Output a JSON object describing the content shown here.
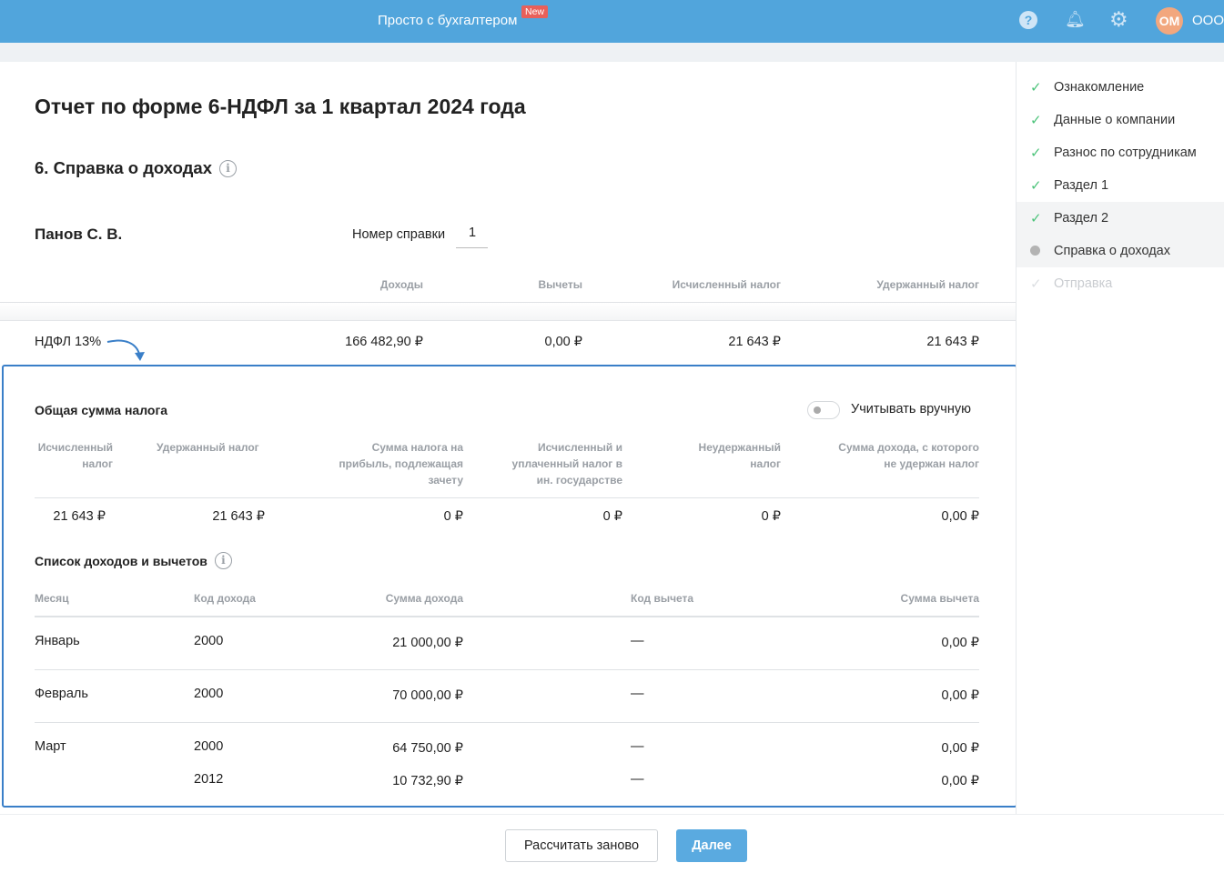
{
  "header": {
    "title": "Просто с бухгалтером",
    "badge": "New",
    "avatar": "ОМ",
    "company": "ООО",
    "icons": [
      "help-icon",
      "bell-icon",
      "gear-icon"
    ]
  },
  "page": {
    "title": "Отчет по форме 6-НДФЛ за 1 квартал 2024 года",
    "section": "6. Справка о доходах",
    "employee": "Панов С. В.",
    "cert_label": "Номер справки",
    "cert_number": "1"
  },
  "summary": {
    "headers": [
      "Доходы",
      "Вычеты",
      "Исчисленный налог",
      "Удержанный налог"
    ],
    "row": {
      "label": "НДФЛ 13%",
      "values": [
        "166 482,90 ₽",
        "0,00 ₽",
        "21 643 ₽",
        "21 643 ₽"
      ]
    }
  },
  "tax": {
    "title": "Общая сумма налога",
    "toggle_label": "Учитывать вручную",
    "toggle_on": false,
    "headers": [
      "Исчисленный налог",
      "Удержанный налог",
      "Сумма налога на прибыль, подлежащая зачету",
      "Исчисленный и уплаченный налог в ин. государстве",
      "Неудержанный налог",
      "Сумма дохода, с которого не удержан налог"
    ],
    "values": [
      "21 643 ₽",
      "21 643 ₽",
      "0 ₽",
      "0 ₽",
      "0 ₽",
      "0,00 ₽"
    ]
  },
  "income": {
    "title": "Список доходов и вычетов",
    "headers": [
      "Месяц",
      "Код дохода",
      "Сумма дохода",
      "Код вычета",
      "Сумма вычета"
    ],
    "rows": [
      {
        "month": "Январь",
        "code": "2000",
        "amount": "21 000,00 ₽",
        "ded_code": "—",
        "ded_amount": "0,00 ₽"
      },
      {
        "month": "Февраль",
        "code": "2000",
        "amount": "70 000,00 ₽",
        "ded_code": "—",
        "ded_amount": "0,00 ₽"
      },
      {
        "month": "Март",
        "code": "2000",
        "amount": "64 750,00 ₽",
        "ded_code": "—",
        "ded_amount": "0,00 ₽"
      },
      {
        "month": "",
        "code": "2012",
        "amount": "10 732,90 ₽",
        "ded_code": "—",
        "ded_amount": "0,00 ₽"
      }
    ]
  },
  "steps": [
    {
      "label": "Ознакомление",
      "state": "done"
    },
    {
      "label": "Данные о компании",
      "state": "done"
    },
    {
      "label": "Разнос по сотрудникам",
      "state": "done"
    },
    {
      "label": "Раздел 1",
      "state": "done"
    },
    {
      "label": "Раздел 2",
      "state": "done"
    },
    {
      "label": "Справка о доходах",
      "state": "current"
    },
    {
      "label": "Отправка",
      "state": "disabled"
    }
  ],
  "footer": {
    "recalc": "Рассчитать заново",
    "next": "Далее"
  },
  "colors": {
    "header": "#51a5dc",
    "accent": "#3a7fc8",
    "check": "#4cc37a",
    "badge": "#e8605a",
    "avatar": "#f2a77e"
  }
}
